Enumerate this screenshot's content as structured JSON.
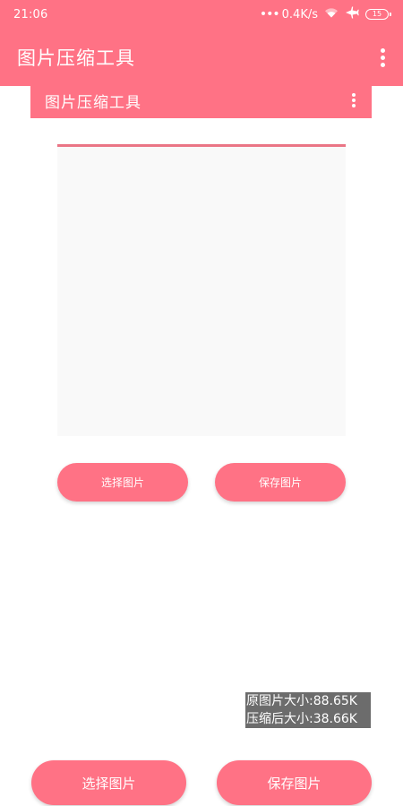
{
  "status_bar": {
    "time": "21:06",
    "network_speed": "0.4K/s",
    "dots_glyph": "•••",
    "wifi_icon": "wifi-icon",
    "airplane_icon": "airplane-icon",
    "battery_level": "15"
  },
  "app_bar": {
    "title": "图片压缩工具",
    "menu_icon": "more-vert-icon"
  },
  "inner_app_bar": {
    "title": "图片压缩工具",
    "menu_icon": "more-vert-icon"
  },
  "preview": {
    "accent_color": "#ea7585"
  },
  "inner_buttons": {
    "select_label": "选择图片",
    "save_label": "保存图片"
  },
  "info": {
    "original_size": "原图片大小:88.65K",
    "compressed_size": "压缩后大小:38.66K"
  },
  "main_buttons": {
    "select_label": "选择图片",
    "save_label": "保存图片"
  },
  "colors": {
    "primary": "#ff7285",
    "preview_bg": "#f9f9f9",
    "info_bg": "#6c6c6c"
  }
}
